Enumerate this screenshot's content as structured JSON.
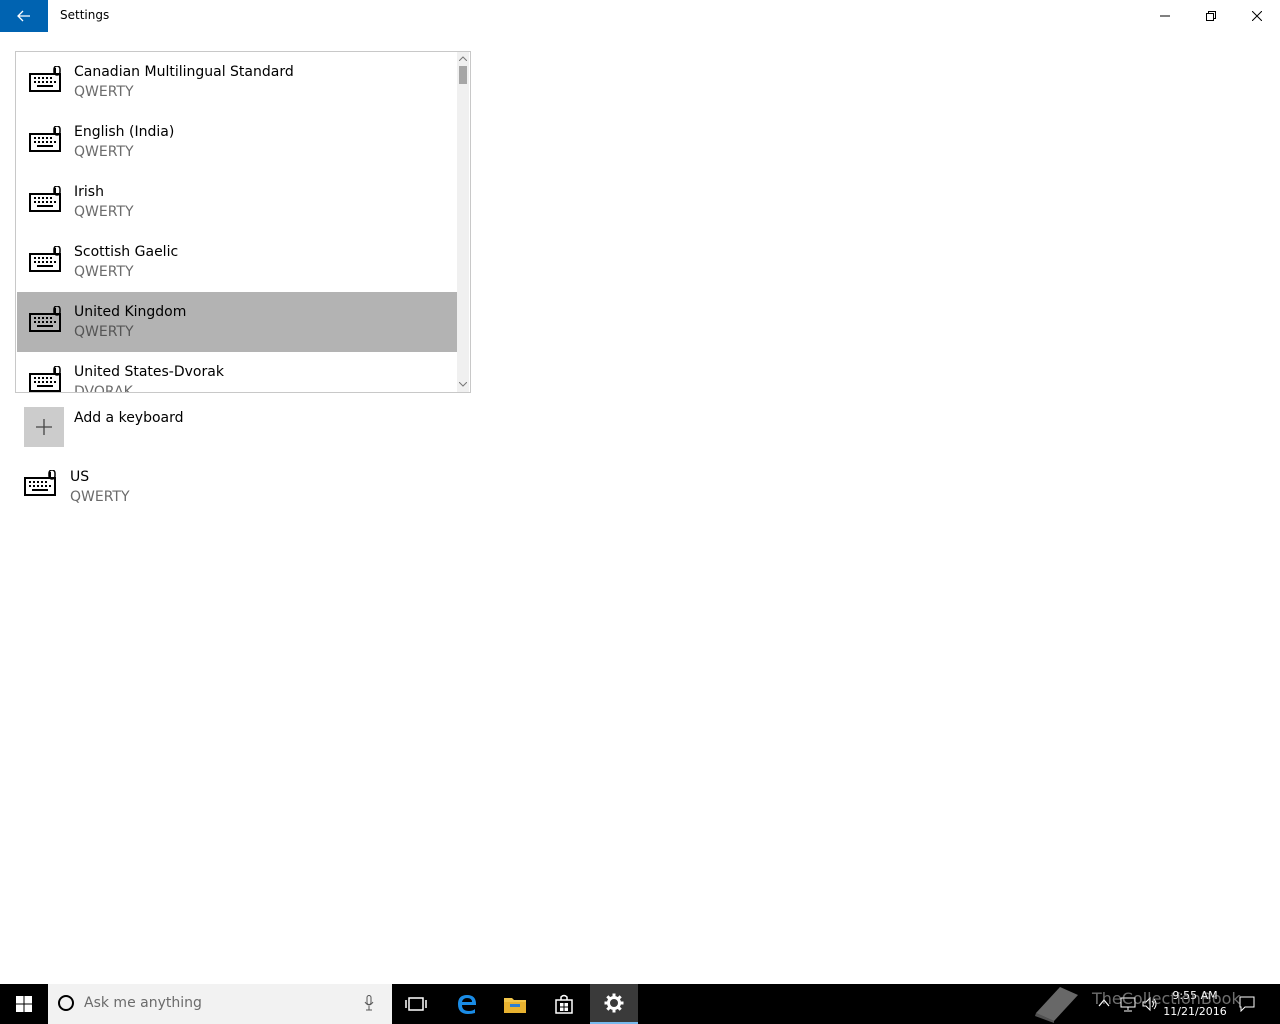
{
  "window": {
    "title": "Settings"
  },
  "keyboard_list": {
    "items": [
      {
        "name": "Canadian Multilingual Standard",
        "layout": "QWERTY"
      },
      {
        "name": "English (India)",
        "layout": "QWERTY"
      },
      {
        "name": "Irish",
        "layout": "QWERTY"
      },
      {
        "name": "Scottish Gaelic",
        "layout": "QWERTY"
      },
      {
        "name": "United Kingdom",
        "layout": "QWERTY"
      },
      {
        "name": "United States-Dvorak",
        "layout": "DVORAK"
      }
    ],
    "selected_index": 4
  },
  "add_keyboard": {
    "label": "Add a keyboard"
  },
  "installed_keyboard": {
    "name": "US",
    "layout": "QWERTY"
  },
  "taskbar": {
    "search_placeholder": "Ask me anything",
    "time": "9:55 AM",
    "date": "11/21/2016",
    "watermark": "TheCollectionBook"
  },
  "colors": {
    "accent": "#0063b1",
    "selected_row": "#b3b3b3",
    "secondary_text": "#6b6b6b"
  },
  "icons": {
    "back": "arrow-left-icon",
    "minimize": "minimize-icon",
    "maximize": "restore-icon",
    "close": "close-icon",
    "keyboard": "keyboard-icon",
    "add": "plus-icon"
  }
}
